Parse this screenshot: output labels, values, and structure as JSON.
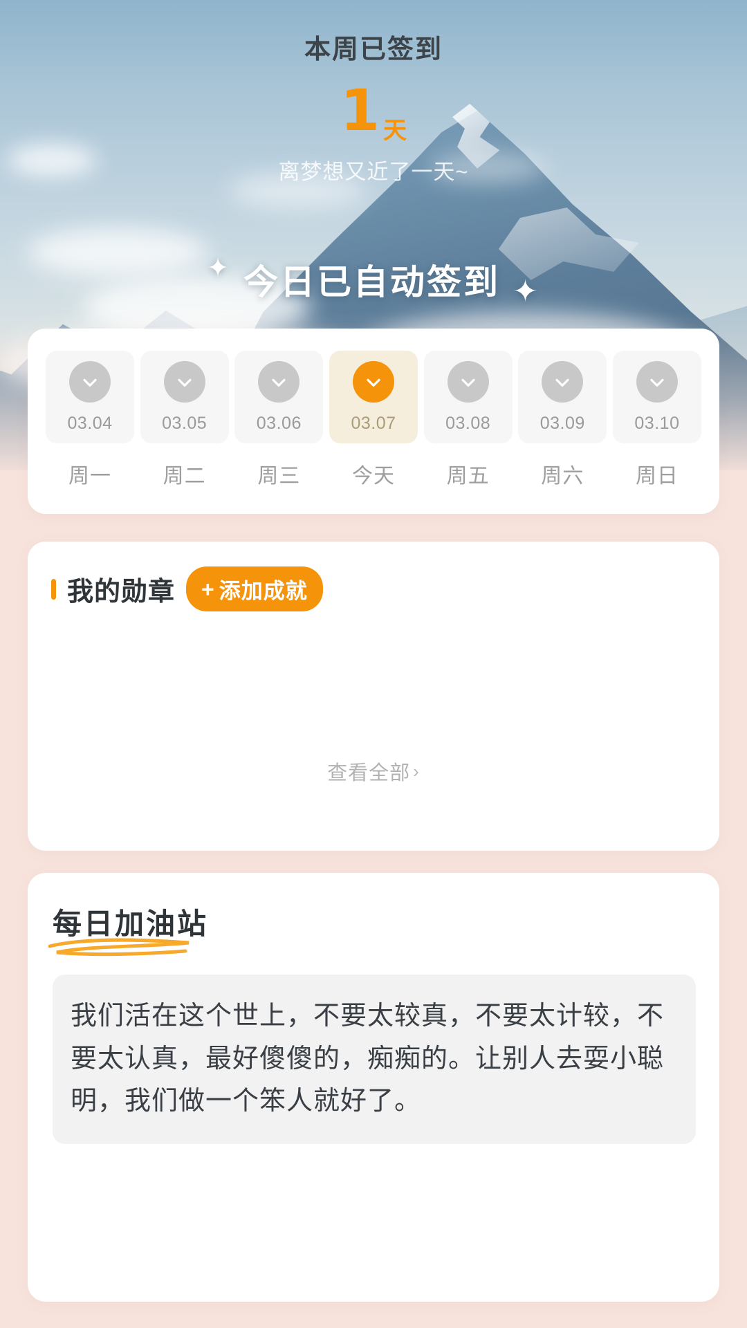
{
  "hero": {
    "title": "本周已签到",
    "streak_number": "1",
    "streak_unit": "天",
    "subtitle": "离梦想又近了一天~",
    "main_heading": "今日已自动签到",
    "sparkle_left": "✦",
    "sparkle_right": "✦",
    "accent_color": "#F5930A"
  },
  "calendar": {
    "days": [
      {
        "date": "03.04",
        "week": "周一",
        "checked": true,
        "today": false
      },
      {
        "date": "03.05",
        "week": "周二",
        "checked": true,
        "today": false
      },
      {
        "date": "03.06",
        "week": "周三",
        "checked": true,
        "today": false
      },
      {
        "date": "03.07",
        "week": "今天",
        "checked": true,
        "today": true
      },
      {
        "date": "03.08",
        "week": "周五",
        "checked": true,
        "today": false
      },
      {
        "date": "03.09",
        "week": "周六",
        "checked": true,
        "today": false
      },
      {
        "date": "03.10",
        "week": "周日",
        "checked": true,
        "today": false
      }
    ],
    "today_bg": "#F5EEDC",
    "today_circle": "#F5930A",
    "idle_circle": "#C8C8C8"
  },
  "badges": {
    "section_title": "我的勋章",
    "add_plus": "+",
    "add_label": "添加成就",
    "view_all_label": "查看全部",
    "view_all_chevron": "›"
  },
  "daily": {
    "section_title": "每日加油站",
    "quote": "我们活在这个世上，不要太较真，不要太计较，不要太认真，最好傻傻的，痴痴的。让别人去耍小聪明，我们做一个笨人就好了。"
  }
}
